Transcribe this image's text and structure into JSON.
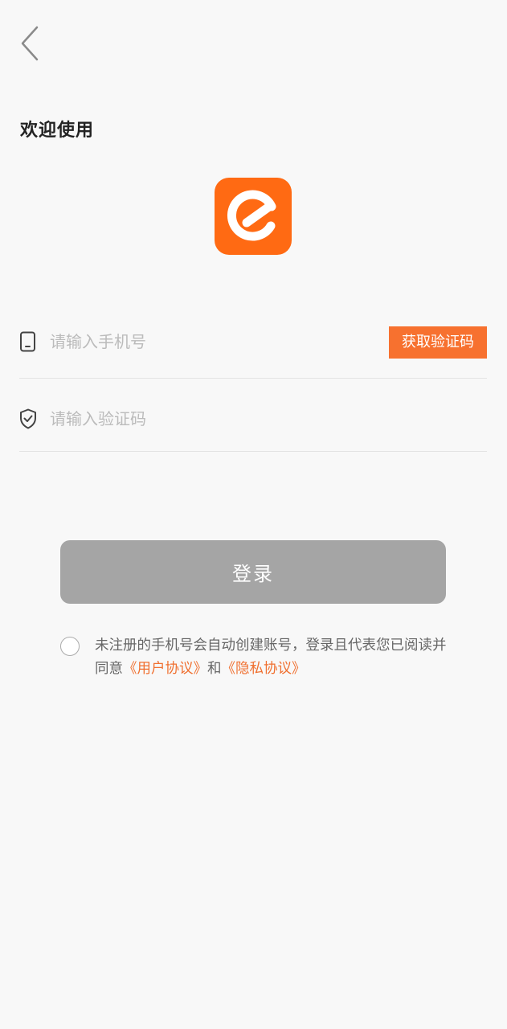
{
  "header": {
    "back_icon": "chevron-left-icon"
  },
  "welcome": {
    "title": "欢迎使用"
  },
  "logo": {
    "icon": "app-e-logo-icon",
    "color": "#ff6a13"
  },
  "phone_field": {
    "icon": "phone-icon",
    "placeholder": "请输入手机号",
    "value": "",
    "get_code_label": "获取验证码"
  },
  "code_field": {
    "icon": "shield-check-icon",
    "placeholder": "请输入验证码",
    "value": ""
  },
  "login": {
    "label": "登录"
  },
  "agreement": {
    "checked": false,
    "text_before": "未注册的手机号会自动创建账号，登录且代表您已阅读并同意",
    "user_agreement_link": "《用户协议》",
    "connector": "和",
    "privacy_link": "《隐私协议》"
  },
  "colors": {
    "accent": "#f7712f",
    "link": "#f07030",
    "login_disabled": "#a5a5a5",
    "background": "#f8f8f8"
  }
}
